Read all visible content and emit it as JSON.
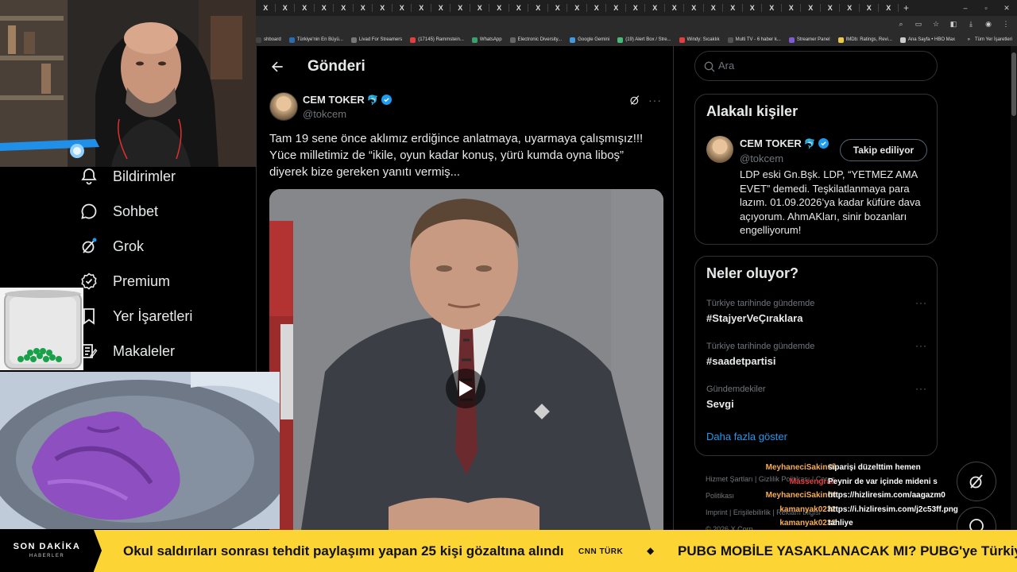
{
  "browser": {
    "tab_glyph": "X",
    "tab_count": 33,
    "new_tab": "+",
    "window_controls": [
      "–",
      "▫",
      "✕"
    ],
    "bookmarks": [
      {
        "label": "shboard",
        "color": "#444"
      },
      {
        "label": "Türkiye'nin En Büyü...",
        "color": "#2b6cb0"
      },
      {
        "label": "Livad For Streamers",
        "color": "#777"
      },
      {
        "label": "(17145) Rammstein...",
        "color": "#e53e3e"
      },
      {
        "label": "WhatsApp",
        "color": "#38a169"
      },
      {
        "label": "Electronic Diversity...",
        "color": "#666"
      },
      {
        "label": "Google Gemini",
        "color": "#4299e1"
      },
      {
        "label": "(19) Alert Box / Stre...",
        "color": "#48bb78"
      },
      {
        "label": "Windy: Sıcaklık",
        "color": "#e53e3e"
      },
      {
        "label": "Multi TV - 6 haber k...",
        "color": "#555"
      },
      {
        "label": "Streamer Panel",
        "color": "#805ad5"
      },
      {
        "label": "IMDb: Ratings, Revi...",
        "color": "#ecc94b"
      },
      {
        "label": "Ana Sayfa • HBO Max",
        "color": "#ccc"
      }
    ],
    "bookmarks_overflow": "»",
    "all_bookmarks": "Tüm Yer İşaretleri"
  },
  "sidebar_nav": [
    {
      "label": "Bildirimler",
      "icon": "bell-icon"
    },
    {
      "label": "Sohbet",
      "icon": "chat-icon"
    },
    {
      "label": "Grok",
      "icon": "grok-icon"
    },
    {
      "label": "Premium",
      "icon": "premium-icon"
    },
    {
      "label": "Yer İşaretleri",
      "icon": "bookmark-icon"
    },
    {
      "label": "Makaleler",
      "icon": "article-icon"
    }
  ],
  "header": {
    "title": "Gönderi"
  },
  "tweet": {
    "name": "CEM TOKER",
    "name_emoji": "🐬",
    "handle": "@tokcem",
    "text": "Tam 19 sene önce aklımız erdiğince anlatmaya, uyarmaya çalışmışız!!! Yüce milletimiz de “ikile, oyun kadar konuş, yürü kumda oyna liboş” diyerek bize gereken yanıtı vermiş...",
    "more": "···"
  },
  "search": {
    "placeholder": "Ara"
  },
  "related": {
    "title": "Alakalı kişiler",
    "name": "CEM TOKER",
    "name_emoji": "🐬",
    "handle": "@tokcem",
    "follow_label": "Takip ediliyor",
    "bio": "LDP eski Gn.Bşk. LDP, “YETMEZ AMA EVET” demedi. Teşkilatlanmaya para lazım. 01.09.2026’ya kadar küfüre dava açıyorum. AhmAKları, sinir bozanları engelliyorum!"
  },
  "trends": {
    "title": "Neler oluyor?",
    "items": [
      {
        "context": "Türkiye tarihinde gündemde",
        "tag": "#StajyerVeÇıraklara"
      },
      {
        "context": "Türkiye tarihinde gündemde",
        "tag": "#saadetpartisi"
      },
      {
        "context": "Gündemdekiler",
        "tag": "Sevgi"
      }
    ],
    "more": "···",
    "show_more": "Daha fazla göster"
  },
  "footer": {
    "row1": "Hizmet Şartları  |  Gizlilik Politikası  |  Çerez Politikası",
    "row2": "Imprint  |  Erişilebilirlik  |  Reklam bilgisi",
    "row3": "© 2026 X Corp."
  },
  "chat": [
    {
      "user": "MeyhaneciSakinOl",
      "color": "#f6ad55",
      "msg": "siparişi düzelttim hemen"
    },
    {
      "user": "Massengrab",
      "color": "#e53e3e",
      "msg": "Peynir de var içinde mideni s"
    },
    {
      "user": "MeyhaneciSakinOl",
      "color": "#f6ad55",
      "msg": "https://hizliresim.com/aagazm0"
    },
    {
      "user": "kamanyak0232",
      "color": "#f6ad55",
      "msg": "https://i.hizliresim.com/j2c53ff.png"
    },
    {
      "user": "kamanyak0232",
      "color": "#f6ad55",
      "msg": "tahliye"
    }
  ],
  "ticker": {
    "label1": "SON DAKİKA",
    "label2": "HABERLER",
    "headline1": "Okul saldırıları sonrası tehdit paylaşımı yapan 25 kişi gözaltına alındı",
    "source1": "CNN TÜRK",
    "separator": "◆",
    "headline2": "PUBG MOBİLE YASAKLANACAK MI? PUBG'ye Türkiye'den"
  },
  "colors": {
    "accent": "#1d9bf0",
    "ticker_bg": "#fcd535",
    "border": "#2f3336"
  }
}
